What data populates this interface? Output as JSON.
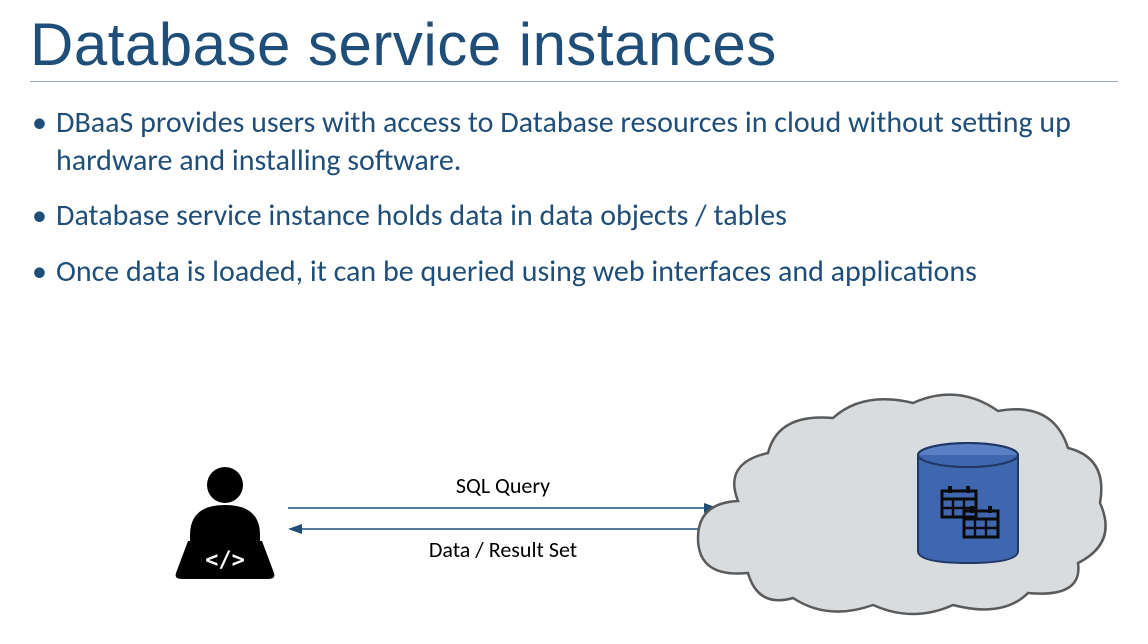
{
  "title": "Database service instances",
  "bullets": [
    "DBaaS provides users with access to Database resources in cloud without setting up hardware and installing software.",
    "Database service instance holds data in data objects / tables",
    "Once data is loaded, it can be queried using web interfaces and applications"
  ],
  "diagram": {
    "arrow_top_label": "SQL Query",
    "arrow_bottom_label": "Data / Result Set",
    "user_label": "</>",
    "colors": {
      "title": "#1f4e79",
      "bullet_text": "#1f4e79",
      "arrow": "#1f4e79",
      "cloud_stroke": "#5a5a5a",
      "cloud_fill": "#d9dcdf",
      "db_fill": "#3f67af",
      "db_stroke": "#1f3864"
    }
  }
}
